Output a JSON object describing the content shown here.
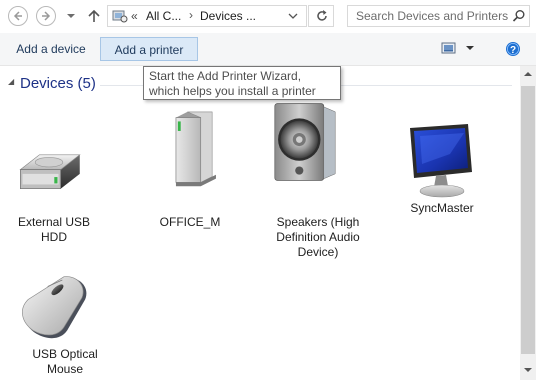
{
  "breadcrumb": {
    "overflow": "«",
    "items": [
      "All C...",
      "Devices ..."
    ],
    "separator": "›"
  },
  "search": {
    "placeholder": "Search Devices and Printers"
  },
  "toolbar": {
    "add_device": "Add a device",
    "add_printer": "Add a printer"
  },
  "tooltip": {
    "text": "Start the Add Printer Wizard, which helps you install a printer"
  },
  "group": {
    "title": "Devices (5)",
    "collapse_glyph": "◢"
  },
  "devices": [
    {
      "label": "External USB HDD",
      "icon": "external-hdd-icon"
    },
    {
      "label": "OFFICE_M",
      "icon": "computer-tower-icon"
    },
    {
      "label": "Speakers (High Definition Audio Device)",
      "icon": "speaker-icon"
    },
    {
      "label": "SyncMaster",
      "icon": "monitor-icon"
    },
    {
      "label": "USB Optical Mouse",
      "icon": "mouse-icon"
    }
  ],
  "colors": {
    "accent": "#1e395b",
    "selected_bg": "#dbe9f7",
    "group_title": "#1e3287",
    "help": "#1e6fd0"
  }
}
